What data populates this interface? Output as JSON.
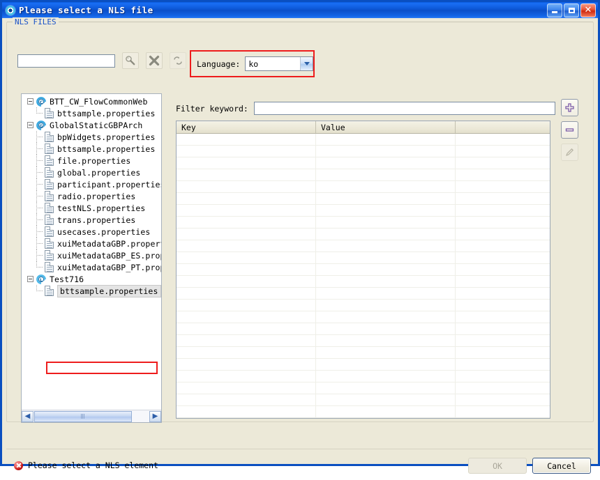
{
  "window": {
    "title": "Please select a NLS file",
    "icon": "dialog-ring-icon",
    "buttons": {
      "minimize": "minimize-icon",
      "maximize": "maximize-icon",
      "close": "close-icon"
    }
  },
  "group": {
    "label": "NLS FILES"
  },
  "toolbar": {
    "search_value": "",
    "search_placeholder": "",
    "buttons": [
      {
        "name": "search-wand-icon",
        "title": ""
      },
      {
        "name": "clear-filter-icon",
        "title": ""
      },
      {
        "name": "refresh-sync-icon",
        "title": ""
      }
    ]
  },
  "language": {
    "label": "Language:",
    "value": "ko",
    "options": [
      "ko"
    ],
    "highlight_color": "#ee1c1c"
  },
  "tree": {
    "nodes": [
      {
        "label": "BTT_CW_FlowCommonWeb",
        "type": "project",
        "letter": "C",
        "expanded": true,
        "level": 0,
        "selected": false
      },
      {
        "label": "bttsample.properties",
        "type": "file",
        "level": 1,
        "selected": false,
        "last": true
      },
      {
        "label": "GlobalStaticGBPArch",
        "type": "project",
        "letter": "G",
        "expanded": true,
        "level": 0,
        "selected": false
      },
      {
        "label": "bpWidgets.properties",
        "type": "file",
        "level": 1,
        "selected": false
      },
      {
        "label": "bttsample.properties",
        "type": "file",
        "level": 1,
        "selected": false
      },
      {
        "label": "file.properties",
        "type": "file",
        "level": 1,
        "selected": false
      },
      {
        "label": "global.properties",
        "type": "file",
        "level": 1,
        "selected": false
      },
      {
        "label": "participant.properties",
        "type": "file",
        "level": 1,
        "selected": false
      },
      {
        "label": "radio.properties",
        "type": "file",
        "level": 1,
        "selected": false
      },
      {
        "label": "testNLS.properties",
        "type": "file",
        "level": 1,
        "selected": false
      },
      {
        "label": "trans.properties",
        "type": "file",
        "level": 1,
        "selected": false
      },
      {
        "label": "usecases.properties",
        "type": "file",
        "level": 1,
        "selected": false
      },
      {
        "label": "xuiMetadataGBP.properties",
        "type": "file",
        "level": 1,
        "selected": false
      },
      {
        "label": "xuiMetadataGBP_ES.properties",
        "type": "file",
        "level": 1,
        "selected": false
      },
      {
        "label": "xuiMetadataGBP_PT.properties",
        "type": "file",
        "level": 1,
        "selected": false,
        "last": true
      },
      {
        "label": "Test716",
        "type": "project",
        "letter": "L",
        "expanded": true,
        "level": 0,
        "selected": false
      },
      {
        "label": "bttsample.properties",
        "type": "file",
        "level": 1,
        "selected": true,
        "last": true
      }
    ],
    "scrollbar": {
      "left_arrow": "◀",
      "right_arrow": "▶"
    }
  },
  "filter": {
    "label": "Filter keyword:",
    "value": "",
    "placeholder": ""
  },
  "table": {
    "columns": [
      "Key",
      "Value",
      ""
    ],
    "rows": [],
    "empty_row_count": 24
  },
  "side_buttons": [
    {
      "name": "add-button",
      "icon": "plus-icon",
      "enabled": true
    },
    {
      "name": "remove-button",
      "icon": "minus-icon",
      "enabled": true
    },
    {
      "name": "edit-button",
      "icon": "pencil-icon",
      "enabled": false
    }
  ],
  "status": {
    "icon": "error-icon",
    "message": "Please select a NLS element"
  },
  "dialog_buttons": {
    "ok_label": "OK",
    "ok_enabled": false,
    "cancel_label": "Cancel",
    "cancel_focused": true
  }
}
